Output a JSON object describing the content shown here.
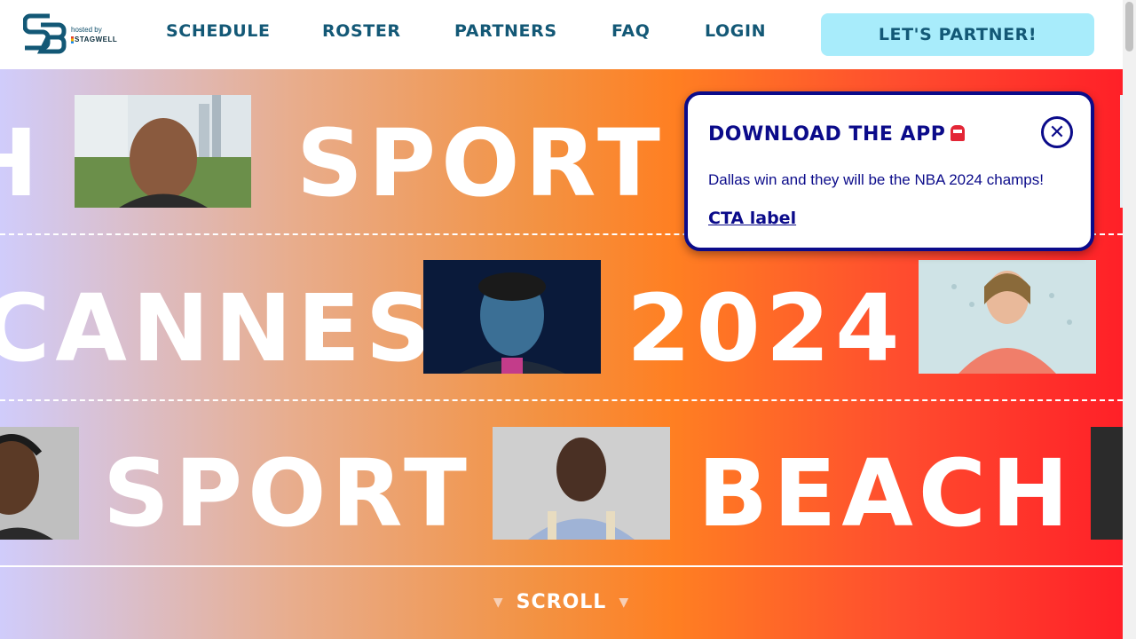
{
  "header": {
    "logo_text": "SB",
    "hosted_by": "hosted by",
    "host_brand": "STAGWELL",
    "nav": [
      "SCHEDULE",
      "ROSTER",
      "PARTNERS",
      "FAQ",
      "LOGIN"
    ],
    "cta_label": "LET'S PARTNER!"
  },
  "hero": {
    "row1": {
      "left_fragment": "H",
      "word": "SPORT"
    },
    "row2": {
      "word1": "CANNES",
      "word2": "2024"
    },
    "row3": {
      "word1": "SPORT",
      "word2": "BEACH"
    },
    "scroll_label": "SCROLL"
  },
  "popup": {
    "title": "DOWNLOAD THE APP",
    "message": "Dallas win and they will be the NBA 2024 champs!",
    "link_label": "CTA label"
  },
  "colors": {
    "brand": "#135876",
    "cta_bg": "#a8ecfb",
    "popup_accent": "#0b0b8a",
    "hero_gradient": [
      "#d0ccfb",
      "#f39242",
      "#ff2028"
    ]
  }
}
